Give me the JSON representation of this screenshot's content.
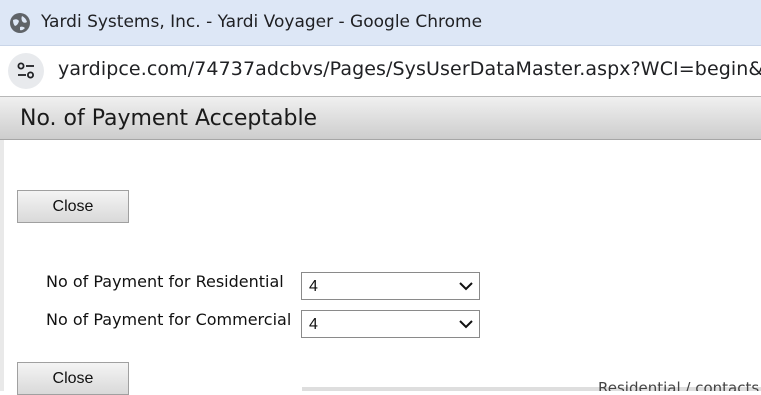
{
  "browser": {
    "window_title": "Yardi Systems, Inc. - Yardi Voyager - Google Chrome",
    "url": "yardipce.com/74737adcbvs/Pages/SysUserDataMaster.aspx?WCI=begin&Act",
    "globe_icon": "globe-icon",
    "site_info_icon": "tune-icon"
  },
  "dialog": {
    "title": "No. of Payment Acceptable",
    "close_top_label": "Close",
    "close_bottom_label": "Close",
    "fields": [
      {
        "label": "No of Payment for Residential",
        "value": "4"
      },
      {
        "label": "No of Payment for Commercial",
        "value": "4"
      }
    ]
  },
  "background": {
    "partial_text": "Residential / contacts"
  }
}
